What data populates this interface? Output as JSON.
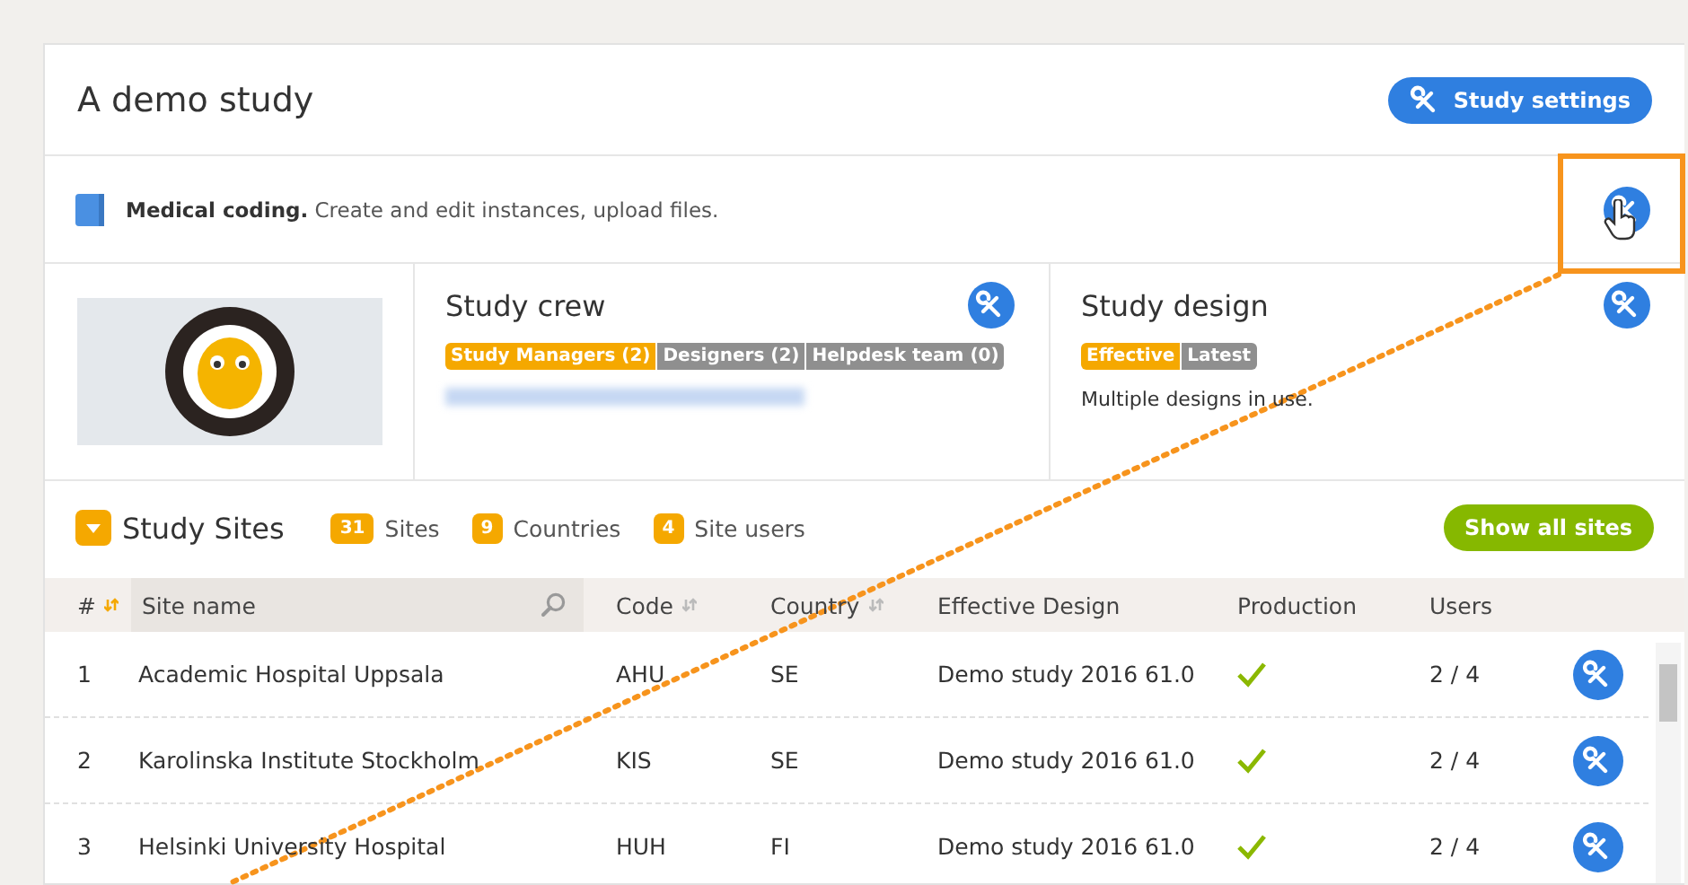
{
  "header": {
    "title": "A demo study",
    "button": "Study settings"
  },
  "module": {
    "text": "**Medical coding.** Create and edit instances, upload files."
  },
  "crew": {
    "title": "Study crew",
    "tabs": [
      {
        "label": "Study Managers (2)",
        "selected": true
      },
      {
        "label": "Designers (2)",
        "selected": false
      },
      {
        "label": "Helpdesk team (0)",
        "selected": false
      }
    ]
  },
  "design": {
    "title": "Study design",
    "tabs": [
      {
        "label": "Effective",
        "selected": true
      },
      {
        "label": "Latest",
        "selected": false
      }
    ],
    "note": "Multiple designs in use."
  },
  "sites": {
    "title": "Study Sites",
    "expanded": true,
    "stats": [
      {
        "count": "31",
        "label": "Sites"
      },
      {
        "count": "9",
        "label": "Countries"
      },
      {
        "count": "4",
        "label": "Site users"
      }
    ],
    "button": "Show all sites"
  },
  "table": {
    "columns": [
      {
        "label": "#",
        "sortable": true,
        "sorted": true,
        "searchable": false
      },
      {
        "label": "Site name",
        "sortable": false,
        "sorted": false,
        "searchable": true
      },
      {
        "label": "Code",
        "sortable": true,
        "sorted": false,
        "searchable": false
      },
      {
        "label": "Country",
        "sortable": true,
        "sorted": false,
        "searchable": false
      },
      {
        "label": "Effective Design",
        "sortable": false,
        "sorted": false,
        "searchable": false
      },
      {
        "label": "Production",
        "sortable": false,
        "sorted": false,
        "searchable": false
      },
      {
        "label": "Users",
        "sortable": false,
        "sorted": false,
        "searchable": false
      }
    ],
    "rows": [
      {
        "num": "1",
        "name": "Academic Hospital Uppsala",
        "code": "AHU",
        "country": "SE",
        "design": "Demo study 2016 61.0",
        "production": true,
        "users": "2 / 4"
      },
      {
        "num": "2",
        "name": "Karolinska Institute Stockholm",
        "code": "KIS",
        "country": "SE",
        "design": "Demo study 2016 61.0",
        "production": true,
        "users": "2 / 4"
      },
      {
        "num": "3",
        "name": "Helsinki University Hospital",
        "code": "HUH",
        "country": "FI",
        "design": "Demo study 2016 61.0",
        "production": true,
        "users": "2 / 4"
      }
    ]
  }
}
